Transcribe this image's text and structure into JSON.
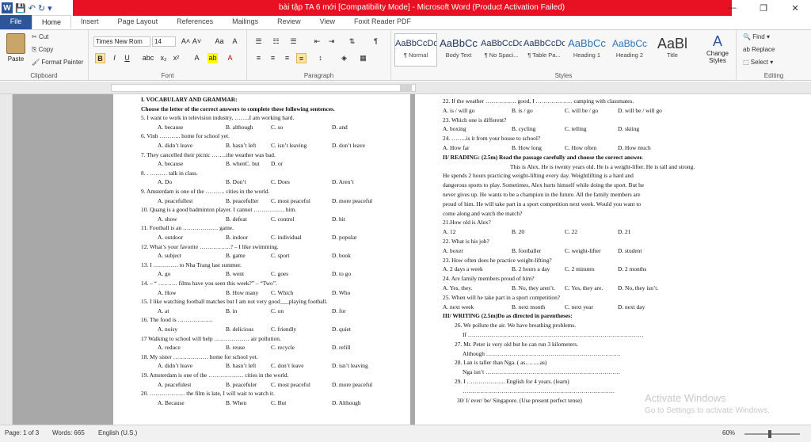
{
  "window": {
    "title": "bài tập TA 6 mới [Compatibility Mode] - Microsoft Word (Product Activation Failed)",
    "minimize": "—",
    "restore": "❐",
    "close": "✕",
    "logo": "W"
  },
  "qat": {
    "save_icon": "save-icon",
    "undo_icon": "undo-icon",
    "redo_icon": "redo-icon"
  },
  "tabs": [
    "File",
    "Home",
    "Insert",
    "Page Layout",
    "References",
    "Mailings",
    "Review",
    "View",
    "Foxit Reader PDF"
  ],
  "ribbon": {
    "clipboard": {
      "paste": "Paste",
      "cut": "Cut",
      "copy": "Copy",
      "format_painter": "Format Painter",
      "label": "Clipboard"
    },
    "font": {
      "name": "Times New Rom",
      "size": "14",
      "label": "Font",
      "bold": "B",
      "italic": "I",
      "underline": "U",
      "strike": "abc",
      "sub": "x₂",
      "sup": "x²",
      "grow": "A˄",
      "shrink": "A˅",
      "case": "Aa",
      "clear": "A",
      "highlight": "ab",
      "color": "A"
    },
    "paragraph": {
      "label": "Paragraph",
      "show_marks": "¶"
    },
    "styles": {
      "label": "Styles",
      "items": [
        {
          "sample": "AaBbCcDc",
          "name": "¶ Normal"
        },
        {
          "sample": "AaBbCc",
          "name": "Body Text"
        },
        {
          "sample": "AaBbCcDc",
          "name": "¶ No Spaci..."
        },
        {
          "sample": "AaBbCcDc",
          "name": "¶ Table Pa..."
        },
        {
          "sample": "AaBbCc",
          "name": "Heading 1"
        },
        {
          "sample": "AaBbCc",
          "name": "Heading 2"
        },
        {
          "sample": "AaBl",
          "name": "Title"
        }
      ],
      "change_styles": "Change Styles"
    },
    "editing": {
      "label": "Editing",
      "find": "Find",
      "replace": "Replace",
      "select": "Select"
    }
  },
  "page1": [
    "I. VOCABULARY AND GRAMMAR:",
    "Choose the letter of the correct answers to complete these following sentences.",
    "5. I want to work in television industry, ……..I am working hard.",
    "A. because|B. although|C. so|D. and",
    "6. Vinh ……….. home for school yet.",
    "A. didn’t leave|B. hasn’t left|C. isn’t leaving|D. don’t leave",
    "7. They cancelled their picnic ……..the weather was bad.",
    "A. because|B. whenC. but|D. or",
    "8. . ……… talk in class.",
    "A. Do|B. Don’t|C. Does|D. Aren’t",
    "9. Amsterdam is one of the ………. cities in the world.",
    "A. peacefullest|B. peacefuller|C. most peaceful|D. more peaceful",
    "10. Quang is a good badminton player. I cannot ……………. him.",
    "A. show|B. defeat|C. control|D. hit",
    "11. Football is an ……………… game.",
    "A. outdoor|B. indoor|C. individual|D. popular",
    "12. What’s your favorite …………….? – I like swimming.",
    "A. subject|B. game|C. sport|D. book",
    "13. I …………. to Nha Trang last summer.",
    "A. go|B. went|C. goes|D. to go",
    "14. – “ ………. films have you seen this week?” – “Two”.",
    "A. How|B. How many|C. Which|D. Who",
    "15. I like watching football matches but I am not very good___playing football.",
    "A. at|B. in|C. on|D. for",
    "16. The food is ………………",
    "A. noisy|B. delicious|C. friendly|D. quiet",
    "17 Walking to school will help ……………… air pollution.",
    "A. reduce|B. reuse|C. recycle|D. refill",
    "18. My sister ……………… home for school yet.",
    "A. didn’t leave|B. hasn’t left|C. don’t leave|D. isn’t leaving",
    "19. Amsterdam is one of the ……………… cities in the world.",
    "A. peacefulest|B. peacefuler|C. most peaceful|D. more peaceful",
    "20. ……………… the film is late, I will wait to watch it.",
    "A. Because|B. When|C. But|D. Although"
  ],
  "page2": [
    "22. If the weather ……………. good, I ………………. camping with classmates.",
    "A. is / will go|B. is / go|C. will be / go|D. will be / will go",
    "23. Which one is different?",
    "A. boxing|B. cycling|C. telling|D. skiing",
    "24. ……..is it from your house to school?",
    "A. How far|B. How long|C. How often|D. How much",
    "II/ READING: (2.5m) Read the passage carefully and choose the correct answer.",
    "This is Alex. He is twenty years old. He is a weight-lifter. He is tall and strong.",
    "He spends 2 hours practicing weight-lifting every day. Weightlifting is a hard and",
    "dangerous sports to play. Sometimes, Alex hurts himself while doing the sport. But he",
    "never gives up. He wants to be a champion in the future. All the family members are",
    "proud of him. He will take part in a sport competition next week. Would you want to",
    "come along and watch the match?",
    "21.How old is Alex?",
    "A. 12|B. 20|C. 22|D. 21",
    "22. What is his job?",
    "A. boxer|B. footballer|C. weight-lifter|D. student",
    "23. How often does he practice weight-lifting?",
    "A. 2 days a week|B. 2 hours a day|C. 2 minutes|D. 2 months",
    "24. Are family members proud of him?",
    "A. Yes, they.|B. No, they aren’t.|C. Yes, they are.|D. No, they isn’t.",
    "25. When will he take part in a sport competition?",
    "A. next week|B. next month|C. next year|D. next day",
    "III/ WRITING (2.5m)Do as directed in parentheses:",
    "26. We pollute the air. We have breathing problems.",
    "If ………………………………………………………………………………",
    "27. Mr. Peter is very old but he can run 3 kilometers.",
    "Although ……………………………………………………………",
    "28. Lan is taller than Nga. ( as……..as)",
    "Nga isn’t ……………………………………………………………",
    "29. I ……………….. English for 4 years. (learn)",
    "……………………………………………………………………",
    "30/ I/ ever/ be/ Singapore. (Use present perfect tense)"
  ],
  "watermark": {
    "line1": "Activate Windows",
    "line2": "Go to Settings to activate Windows."
  },
  "status": {
    "page": "Page: 1 of 3",
    "words": "Words: 665",
    "lang": "English (U.S.)",
    "zoom": "60%"
  }
}
